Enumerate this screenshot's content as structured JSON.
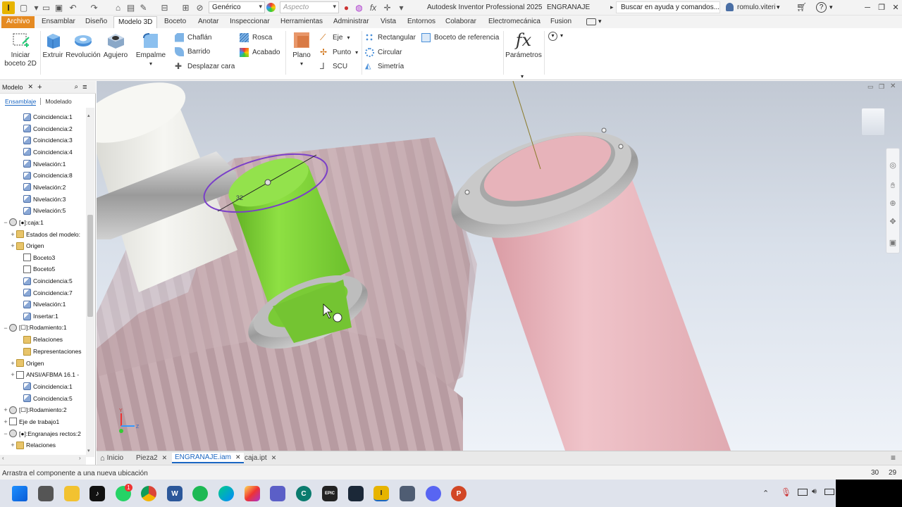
{
  "titlebar": {
    "app_logo": "I",
    "material_combo": "Genérico",
    "appearance_combo": "Aspecto",
    "app_title": "Autodesk Inventor Professional 2025",
    "doc_name": "ENGRANAJE",
    "search_placeholder": "Buscar en ayuda y comandos...",
    "user": "romulo.viteri",
    "help": "?"
  },
  "ribbon_tabs": [
    "Archivo",
    "Ensamblar",
    "Diseño",
    "Modelo 3D",
    "Boceto",
    "Anotar",
    "Inspeccionar",
    "Herramientas",
    "Administrar",
    "Vista",
    "Entornos",
    "Colaborar",
    "Electromecánica",
    "Fusion"
  ],
  "ribbon": {
    "sketch_btn": "Iniciar",
    "sketch_btn2": "boceto 2D",
    "extrude": "Extruir",
    "revolve": "Revolución",
    "hole": "Agujero",
    "fillet": "Empalme",
    "chamfer": "Chaflán",
    "sweep": "Barrido",
    "move_face": "Desplazar cara",
    "thread": "Rosca",
    "finish": "Acabado",
    "plane": "Plano",
    "axis": "Eje",
    "point": "Punto",
    "ucs": "SCU",
    "rectangular": "Rectangular",
    "circular": "Circular",
    "mirror": "Simetría",
    "ref_sketch": "Boceto de referencia",
    "params": "Parámetros",
    "fx": "fx"
  },
  "panel": {
    "title": "Modelo",
    "add": "+",
    "tab_assembly": "Ensamblaje",
    "tab_modeling": "Modelado",
    "rows": [
      {
        "indent": 2,
        "exp": "",
        "icon": "cons",
        "label": "Coincidencia:1"
      },
      {
        "indent": 2,
        "exp": "",
        "icon": "cons",
        "label": "Coincidencia:2"
      },
      {
        "indent": 2,
        "exp": "",
        "icon": "cons",
        "label": "Coincidencia:3"
      },
      {
        "indent": 2,
        "exp": "",
        "icon": "cons",
        "label": "Coincidencia:4"
      },
      {
        "indent": 2,
        "exp": "",
        "icon": "cons",
        "label": "Nivelación:1"
      },
      {
        "indent": 2,
        "exp": "",
        "icon": "cons",
        "label": "Coincidencia:8"
      },
      {
        "indent": 2,
        "exp": "",
        "icon": "cons",
        "label": "Nivelación:2"
      },
      {
        "indent": 2,
        "exp": "",
        "icon": "cons",
        "label": "Nivelación:3"
      },
      {
        "indent": 2,
        "exp": "",
        "icon": "cons",
        "label": "Nivelación:5"
      },
      {
        "indent": 0,
        "exp": "−",
        "icon": "asm",
        "label": "[●]:caja:1"
      },
      {
        "indent": 1,
        "exp": "+",
        "icon": "folder",
        "label": "Estados del modelo:"
      },
      {
        "indent": 1,
        "exp": "+",
        "icon": "folder",
        "label": "Origen"
      },
      {
        "indent": 2,
        "exp": "",
        "icon": "sk",
        "label": "Boceto3"
      },
      {
        "indent": 2,
        "exp": "",
        "icon": "sk",
        "label": "Boceto5"
      },
      {
        "indent": 2,
        "exp": "",
        "icon": "cons",
        "label": "Coincidencia:5"
      },
      {
        "indent": 2,
        "exp": "",
        "icon": "cons",
        "label": "Coincidencia:7"
      },
      {
        "indent": 2,
        "exp": "",
        "icon": "cons",
        "label": "Nivelación:1"
      },
      {
        "indent": 2,
        "exp": "",
        "icon": "cons",
        "label": "Insertar:1"
      },
      {
        "indent": 0,
        "exp": "−",
        "icon": "asm",
        "label": "[☐]:Rodamiento:1"
      },
      {
        "indent": 2,
        "exp": "",
        "icon": "folder",
        "label": "Relaciones"
      },
      {
        "indent": 2,
        "exp": "",
        "icon": "folder",
        "label": "Representaciones"
      },
      {
        "indent": 1,
        "exp": "+",
        "icon": "folder",
        "label": "Origen"
      },
      {
        "indent": 1,
        "exp": "+",
        "icon": "sk",
        "label": "ANSI/AFBMA 16.1 -"
      },
      {
        "indent": 2,
        "exp": "",
        "icon": "cons",
        "label": "Coincidencia:1"
      },
      {
        "indent": 2,
        "exp": "",
        "icon": "cons",
        "label": "Coincidencia:5"
      },
      {
        "indent": 0,
        "exp": "+",
        "icon": "asm",
        "label": "[☐]:Rodamiento:2"
      },
      {
        "indent": 0,
        "exp": "+",
        "icon": "sk",
        "label": "Eje de trabajo1"
      },
      {
        "indent": 0,
        "exp": "−",
        "icon": "asm",
        "label": "[●]:Engranajes rectos:2"
      },
      {
        "indent": 1,
        "exp": "+",
        "icon": "folder",
        "label": "Relaciones"
      }
    ]
  },
  "viewport": {
    "dimension_text": "32",
    "axis_z": "Z",
    "axis_y": "Y"
  },
  "doc_tabs": [
    "Inicio",
    "Pieza2",
    "ENGRANAJE.iam",
    "caja.ipt"
  ],
  "status": {
    "message": "Arrastra el componente a una nueva ubicación",
    "count1": "30",
    "count2": "29"
  },
  "taskbar": {
    "whatsapp_badge": "1",
    "epic_label": "EPIC",
    "inventor_label": "I"
  },
  "colors": {
    "file_tab": "#e58a22",
    "gear": "#cdb3b8",
    "shaft": "#e8b5bc",
    "green_pin": "#7fd03a",
    "ellipse": "#7a3fc8"
  }
}
